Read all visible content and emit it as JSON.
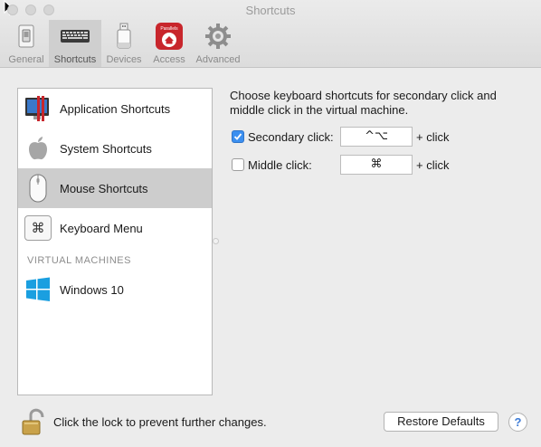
{
  "window": {
    "title": "Shortcuts"
  },
  "toolbar": {
    "items": [
      {
        "label": "General",
        "icon": "general-switch-icon"
      },
      {
        "label": "Shortcuts",
        "icon": "keyboard-icon",
        "selected": true
      },
      {
        "label": "Devices",
        "icon": "usb-drive-icon"
      },
      {
        "label": "Access",
        "icon": "parallels-access-icon",
        "badge": "Parallels"
      },
      {
        "label": "Advanced",
        "icon": "gear-icon"
      }
    ]
  },
  "sidebar": {
    "items": [
      {
        "label": "Application Shortcuts",
        "icon": "application-shortcuts-icon"
      },
      {
        "label": "System Shortcuts",
        "icon": "apple-icon"
      },
      {
        "label": "Mouse Shortcuts",
        "icon": "mouse-icon",
        "selected": true
      },
      {
        "label": "Keyboard Menu",
        "icon": "command-key-icon",
        "glyph": "⌘"
      }
    ],
    "section_header": "VIRTUAL MACHINES",
    "vms": [
      {
        "label": "Windows 10",
        "icon": "windows-logo-icon"
      }
    ]
  },
  "main": {
    "description": "Choose keyboard shortcuts for secondary click and middle click in the virtual machine.",
    "rows": [
      {
        "label": "Secondary click:",
        "checked": true,
        "shortcut": "^⌥",
        "suffix": "+ click"
      },
      {
        "label": "Middle click:",
        "checked": false,
        "shortcut": "⌘",
        "suffix": "+ click"
      }
    ]
  },
  "footer": {
    "lock_text": "Click the lock to prevent further changes.",
    "restore_label": "Restore Defaults",
    "help_label": "?"
  },
  "colors": {
    "selection_gray": "#cdcdcd",
    "checkbox_blue": "#3b8ff0",
    "parallels_red": "#c8262c",
    "windows_blue": "#1a9fe0"
  }
}
